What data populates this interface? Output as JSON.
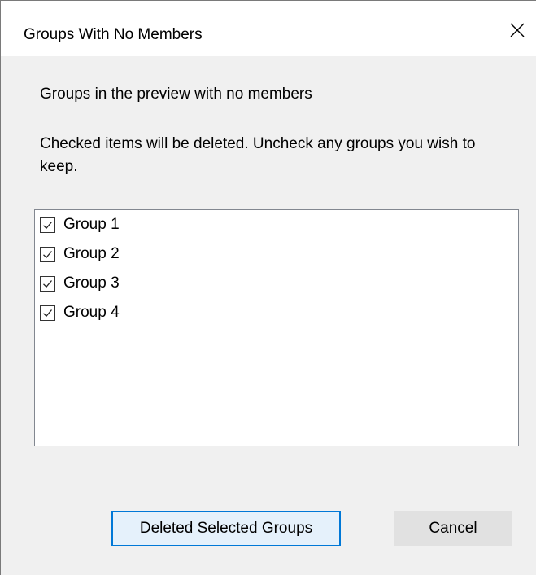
{
  "window": {
    "title": "Groups With No Members",
    "close_icon": "close-icon"
  },
  "content": {
    "heading": "Groups in the preview with no members",
    "instructions": "Checked items will be deleted. Uncheck any groups you wish to keep."
  },
  "groups": [
    {
      "label": "Group 1",
      "checked": true
    },
    {
      "label": "Group 2",
      "checked": true
    },
    {
      "label": "Group 3",
      "checked": true
    },
    {
      "label": "Group 4",
      "checked": true
    }
  ],
  "buttons": {
    "delete_label": "Deleted Selected Groups",
    "cancel_label": "Cancel"
  },
  "colors": {
    "accent": "#0078d7",
    "dialog_background": "#f0f0f0",
    "titlebar_background": "#ffffff"
  }
}
